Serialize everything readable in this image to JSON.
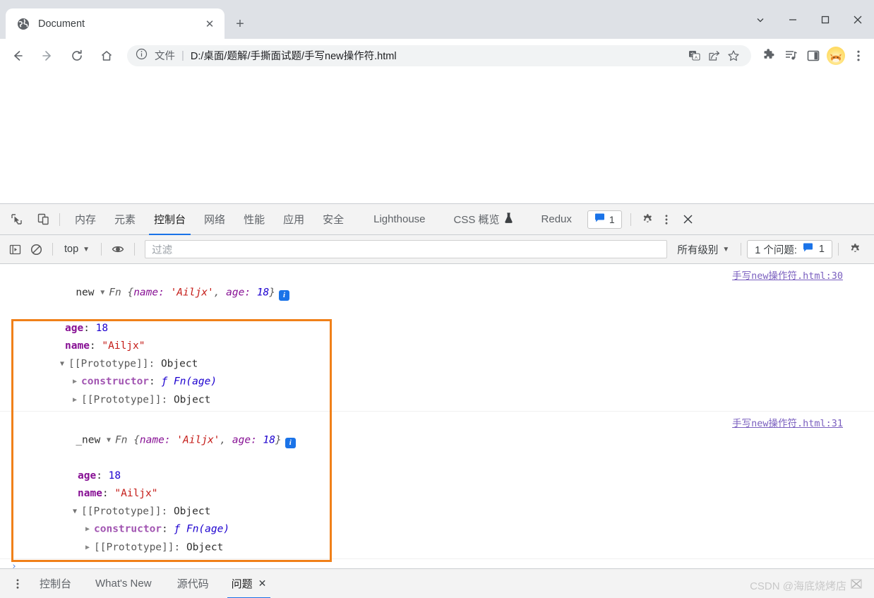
{
  "window": {
    "controls": [
      {
        "name": "chevron-down",
        "glyph": "⌄"
      },
      {
        "name": "minimize",
        "glyph": "—"
      },
      {
        "name": "maximize",
        "glyph": "□"
      },
      {
        "name": "close",
        "glyph": "✕"
      }
    ]
  },
  "tabstrip": {
    "tab_title": "Document",
    "tab_favicon": "globe-icon",
    "close_glyph": "✕",
    "newtab_glyph": "+"
  },
  "navbar": {
    "back_glyph": "←",
    "forward_glyph": "→",
    "reload_glyph": "↻",
    "home_glyph": "⌂",
    "omnibox": {
      "info_icon": "info-circle-icon",
      "scheme_label": "文件",
      "separator": "|",
      "url": "D:/桌面/题解/手撕面试题/手写new操作符.html"
    },
    "right_icons": [
      {
        "name": "translate-icon"
      },
      {
        "name": "share-icon"
      },
      {
        "name": "bookmark-star-icon"
      },
      {
        "name": "extensions-puzzle-icon"
      },
      {
        "name": "media-control-icon"
      },
      {
        "name": "side-panel-icon"
      },
      {
        "name": "profile-avatar"
      },
      {
        "name": "chrome-menu-icon"
      }
    ]
  },
  "devtools": {
    "left_icons": [
      {
        "name": "inspect-element-icon"
      },
      {
        "name": "device-toolbar-icon"
      }
    ],
    "tabs": [
      {
        "label": "内存",
        "active": false,
        "name": "tab-memory"
      },
      {
        "label": "元素",
        "active": false,
        "name": "tab-elements"
      },
      {
        "label": "控制台",
        "active": true,
        "name": "tab-console"
      },
      {
        "label": "网络",
        "active": false,
        "name": "tab-network"
      },
      {
        "label": "性能",
        "active": false,
        "name": "tab-performance"
      },
      {
        "label": "应用",
        "active": false,
        "name": "tab-application"
      },
      {
        "label": "安全",
        "active": false,
        "name": "tab-security"
      },
      {
        "label": "Lighthouse",
        "active": false,
        "name": "tab-lighthouse"
      },
      {
        "label": "CSS 概览",
        "active": false,
        "name": "tab-css-overview",
        "suffix_icon": "flask-icon"
      },
      {
        "label": "Redux",
        "active": false,
        "name": "tab-redux"
      }
    ],
    "message_badge_count": "1",
    "settings_icon": "gear-icon",
    "more_icon": "more-vertical-icon",
    "close_icon": "close-icon",
    "toolbar": {
      "sidebar_icon": "console-sidebar-icon",
      "clear_icon": "clear-console-icon",
      "context_label": "top",
      "context_caret": "▼",
      "eye_icon": "live-expression-eye-icon",
      "filter_placeholder": "过滤",
      "level_label": "所有级别",
      "level_caret": "▼",
      "issues_label": "1 个问题:",
      "issues_count": "1",
      "issues_icon": "issues-message-icon",
      "settings_icon": "gear-icon"
    }
  },
  "console": {
    "prompt_caret": "›",
    "entries": [
      {
        "name": "console-entry-new",
        "log_label": "new",
        "expand_caret": "▼",
        "ctor_name": "Fn",
        "preview_open": "{",
        "preview_key1": "name:",
        "preview_val1": "'Ailjx'",
        "preview_comma": ",",
        "preview_key2": "age:",
        "preview_val2": "18",
        "preview_close": "}",
        "info_glyph": "i",
        "source": "手写new操作符.html:30",
        "props": [
          {
            "key": "age",
            "sep": ":",
            "value": "18",
            "type": "num"
          },
          {
            "key": "name",
            "sep": ":",
            "value": "\"Ailjx\"",
            "type": "str"
          }
        ],
        "proto_caret": "▼",
        "proto_label": "[[Prototype]]:",
        "proto_value": "Object",
        "proto_children": [
          {
            "caret": "▶",
            "key": "constructor",
            "sep": ":",
            "fn": "ƒ Fn(age)",
            "type": "fn"
          },
          {
            "caret": "▶",
            "key": "[[Prototype]]:",
            "value": "Object",
            "type": "obj"
          }
        ]
      },
      {
        "name": "console-entry-_new",
        "log_label": "_new",
        "expand_caret": "▼",
        "ctor_name": "Fn",
        "preview_open": "{",
        "preview_key1": "name:",
        "preview_val1": "'Ailjx'",
        "preview_comma": ",",
        "preview_key2": "age:",
        "preview_val2": "18",
        "preview_close": "}",
        "info_glyph": "i",
        "source": "手写new操作符.html:31",
        "props": [
          {
            "key": "age",
            "sep": ":",
            "value": "18",
            "type": "num"
          },
          {
            "key": "name",
            "sep": ":",
            "value": "\"Ailjx\"",
            "type": "str"
          }
        ],
        "proto_caret": "▼",
        "proto_label": "[[Prototype]]:",
        "proto_value": "Object",
        "proto_children": [
          {
            "caret": "▶",
            "key": "constructor",
            "sep": ":",
            "fn": "ƒ Fn(age)",
            "type": "fn"
          },
          {
            "caret": "▶",
            "key": "[[Prototype]]:",
            "value": "Object",
            "type": "obj"
          }
        ]
      }
    ]
  },
  "drawer": {
    "more_icon": "more-vertical-icon",
    "tabs": [
      {
        "label": "控制台",
        "active": false,
        "name": "drawer-tab-console"
      },
      {
        "label": "What's New",
        "active": false,
        "name": "drawer-tab-whats-new"
      },
      {
        "label": "源代码",
        "active": false,
        "name": "drawer-tab-sources"
      },
      {
        "label": "问题",
        "active": true,
        "name": "drawer-tab-issues",
        "close_glyph": "✕"
      }
    ]
  },
  "watermark": {
    "text": "CSDN @海底烧烤店"
  },
  "colors": {
    "accent_blue": "#1a73e8",
    "annotation_orange": "#f08019",
    "chrome_gray": "#dee1e6",
    "devtools_gray": "#f3f3f3"
  }
}
